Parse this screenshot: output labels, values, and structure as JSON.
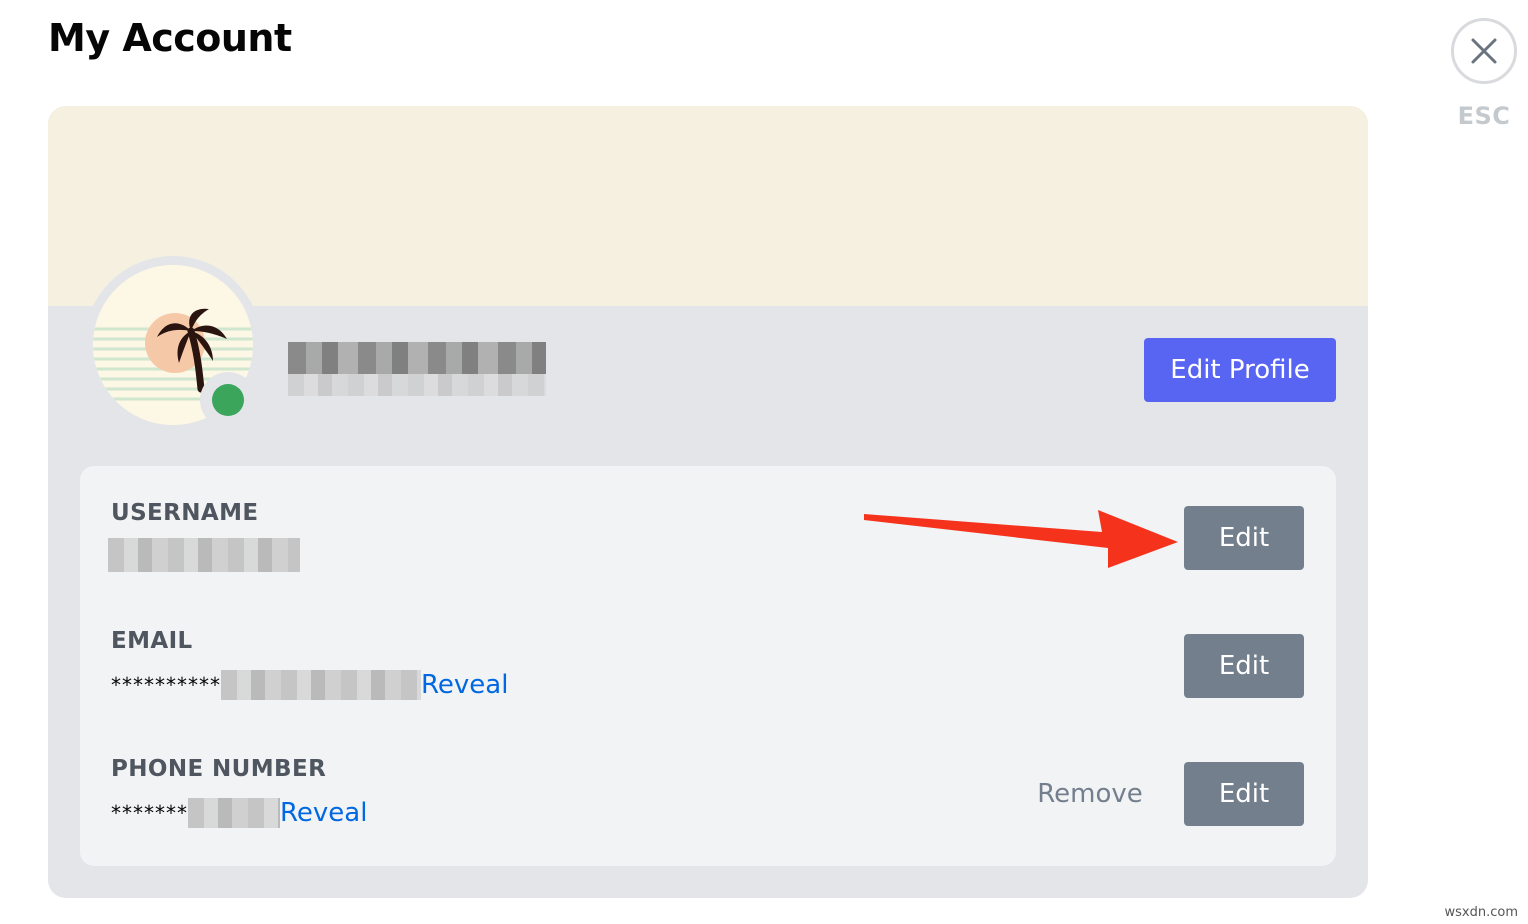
{
  "page": {
    "title": "My Account"
  },
  "close": {
    "icon": "close-icon",
    "esc_label": "ESC"
  },
  "profile": {
    "banner_color": "#f6f0e1",
    "avatar_icon": "palm-tree-avatar",
    "status": "online",
    "status_color": "#3ba55c",
    "edit_profile_label": "Edit Profile",
    "accent_color": "#5865f2"
  },
  "fields": {
    "username": {
      "label": "USERNAME",
      "edit_label": "Edit"
    },
    "email": {
      "label": "EMAIL",
      "masked_value": "**********",
      "reveal_label": "Reveal",
      "edit_label": "Edit"
    },
    "phone": {
      "label": "PHONE NUMBER",
      "masked_value": "*******",
      "reveal_label": "Reveal",
      "remove_label": "Remove",
      "edit_label": "Edit"
    }
  },
  "annotation": {
    "arrow_color": "#f5331c"
  },
  "watermark": {
    "text": "wsxdn.com"
  }
}
